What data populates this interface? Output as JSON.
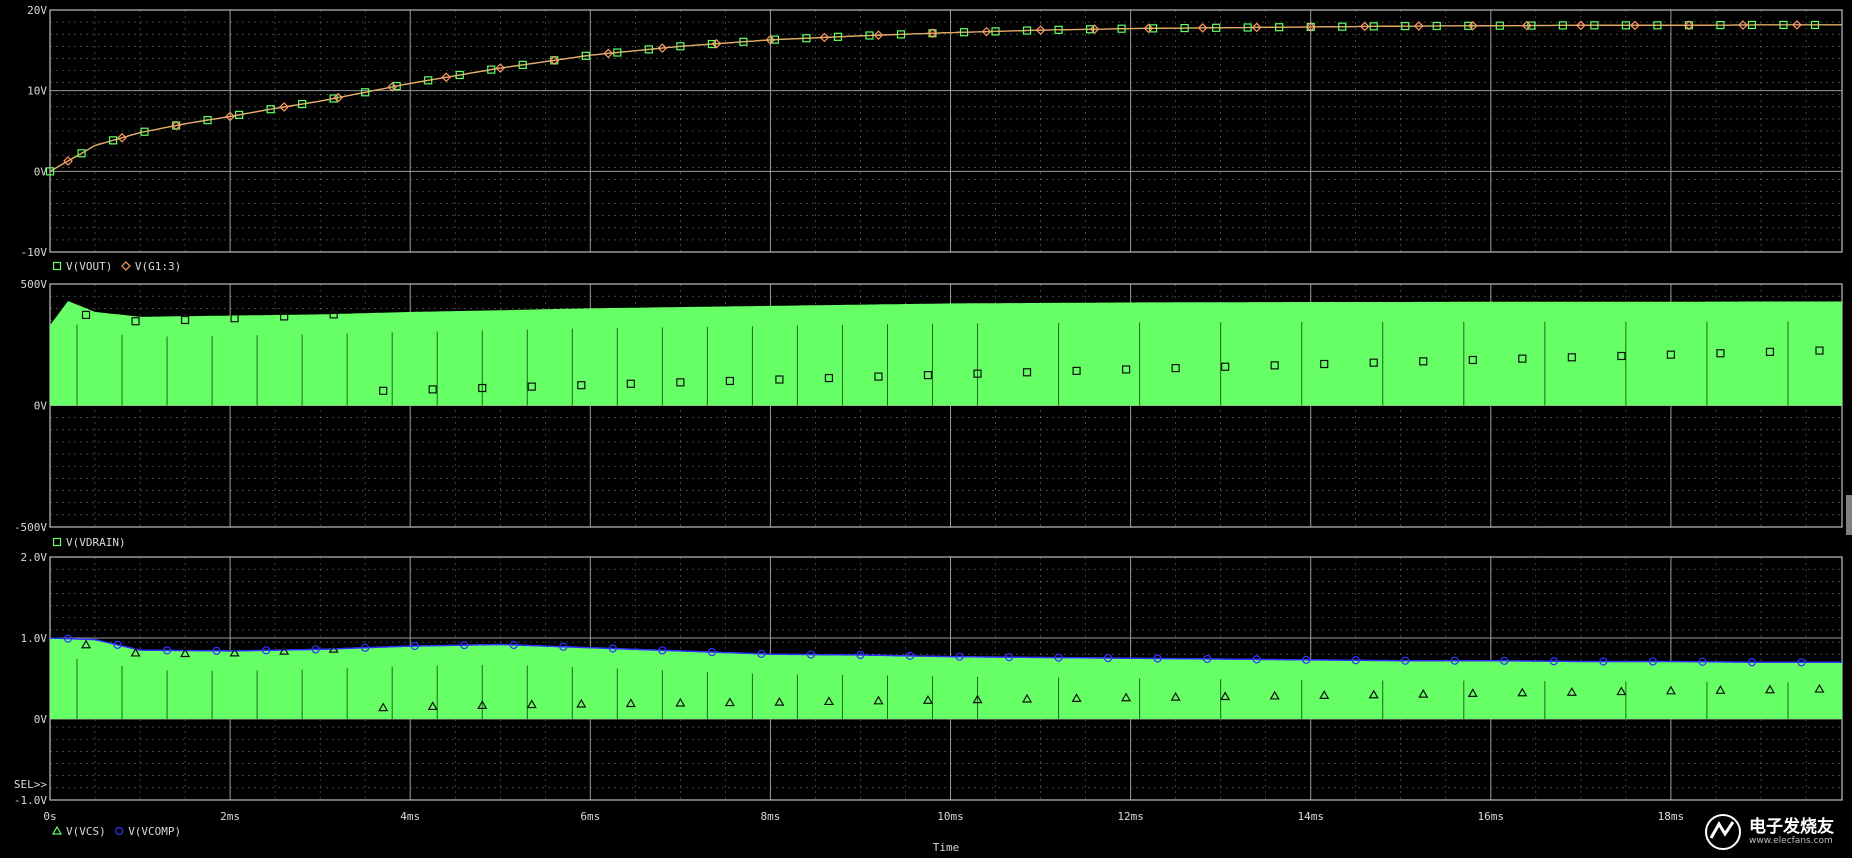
{
  "x_axis": {
    "label": "Time",
    "ticks": [
      "0s",
      "2ms",
      "4ms",
      "6ms",
      "8ms",
      "10ms",
      "12ms",
      "14ms",
      "16ms",
      "18ms"
    ],
    "range_ms": [
      0,
      19.9
    ]
  },
  "colors": {
    "grid": "#9a9a9a",
    "green": "#66ff66",
    "orange": "#ff9966",
    "blue": "#3333ff"
  },
  "panels": [
    {
      "y_ticks": [
        "20V",
        "10V",
        "0V",
        "-10V"
      ],
      "legend": [
        "V(VOUT)",
        "V(G1:3)"
      ]
    },
    {
      "y_ticks": [
        "500V",
        "0V",
        "-500V"
      ],
      "legend": [
        "V(VDRAIN)"
      ]
    },
    {
      "y_ticks": [
        "2.0V",
        "1.0V",
        "0V",
        "-1.0V"
      ],
      "legend": [
        "V(VCS)",
        "V(VCOMP)"
      ],
      "sel_label": "SEL>>"
    }
  ],
  "chart_data": [
    {
      "type": "line",
      "ylim": [
        -10,
        20
      ],
      "series": [
        {
          "name": "V(VOUT)",
          "color": "#66ff66",
          "marker": "square",
          "x": [
            0,
            0.5,
            1,
            1.5,
            2,
            2.5,
            3,
            4,
            5,
            6,
            7,
            8,
            9,
            10,
            11,
            12,
            13,
            14,
            15,
            16,
            17,
            18,
            19,
            19.9
          ],
          "y": [
            0,
            3.2,
            4.8,
            5.9,
            6.8,
            7.8,
            8.7,
            10.9,
            12.8,
            14.4,
            15.5,
            16.3,
            16.8,
            17.2,
            17.5,
            17.7,
            17.8,
            17.9,
            18.0,
            18.05,
            18.1,
            18.1,
            18.15,
            18.15
          ]
        },
        {
          "name": "V(G1:3)",
          "color": "#ff9966",
          "marker": "diamond",
          "x": [
            0,
            0.5,
            1,
            1.5,
            2,
            2.5,
            3,
            4,
            5,
            6,
            7,
            8,
            9,
            10,
            11,
            12,
            13,
            14,
            15,
            16,
            17,
            18,
            19,
            19.9
          ],
          "y": [
            0,
            3.2,
            4.8,
            5.9,
            6.8,
            7.8,
            8.7,
            10.9,
            12.8,
            14.4,
            15.5,
            16.3,
            16.8,
            17.2,
            17.5,
            17.7,
            17.8,
            17.9,
            18.0,
            18.05,
            18.1,
            18.1,
            18.15,
            18.15
          ]
        }
      ]
    },
    {
      "type": "area",
      "ylim": [
        -500,
        500
      ],
      "series": [
        {
          "name": "V(VDRAIN)",
          "color": "#66ff66",
          "marker": "square",
          "x": [
            0,
            0.2,
            0.5,
            1,
            2,
            3,
            4,
            5,
            6,
            7,
            8,
            9,
            10,
            11,
            12,
            13,
            14,
            15,
            16,
            17,
            18,
            19,
            19.9
          ],
          "y": [
            330,
            430,
            385,
            365,
            370,
            375,
            385,
            392,
            400,
            405,
            410,
            415,
            420,
            422,
            424,
            425,
            426,
            426,
            427,
            427,
            427,
            428,
            428
          ]
        }
      ]
    },
    {
      "type": "area",
      "ylim": [
        -1,
        2
      ],
      "series": [
        {
          "name": "V(VCS)",
          "color": "#66ff66",
          "marker": "triangle",
          "x": [
            0,
            0.5,
            1,
            2,
            3,
            4,
            5,
            6,
            7,
            8,
            9,
            10,
            11,
            12,
            13,
            14,
            15,
            16,
            17,
            18,
            19,
            19.9
          ],
          "y": [
            1.0,
            0.98,
            0.85,
            0.84,
            0.86,
            0.9,
            0.92,
            0.88,
            0.84,
            0.8,
            0.79,
            0.77,
            0.76,
            0.75,
            0.74,
            0.73,
            0.72,
            0.72,
            0.71,
            0.71,
            0.7,
            0.7
          ]
        },
        {
          "name": "V(VCOMP)",
          "color": "#3333ff",
          "marker": "circle",
          "x": [
            0,
            0.5,
            1,
            2,
            3,
            4,
            5,
            6,
            7,
            8,
            9,
            10,
            11,
            12,
            13,
            14,
            15,
            16,
            17,
            18,
            19,
            19.9
          ],
          "y": [
            1.0,
            0.98,
            0.85,
            0.84,
            0.86,
            0.9,
            0.92,
            0.88,
            0.84,
            0.8,
            0.79,
            0.77,
            0.76,
            0.75,
            0.74,
            0.73,
            0.72,
            0.72,
            0.71,
            0.71,
            0.7,
            0.7
          ]
        }
      ]
    }
  ],
  "watermark": {
    "text": "电子发烧友",
    "sub": "www.elecfans.com"
  }
}
